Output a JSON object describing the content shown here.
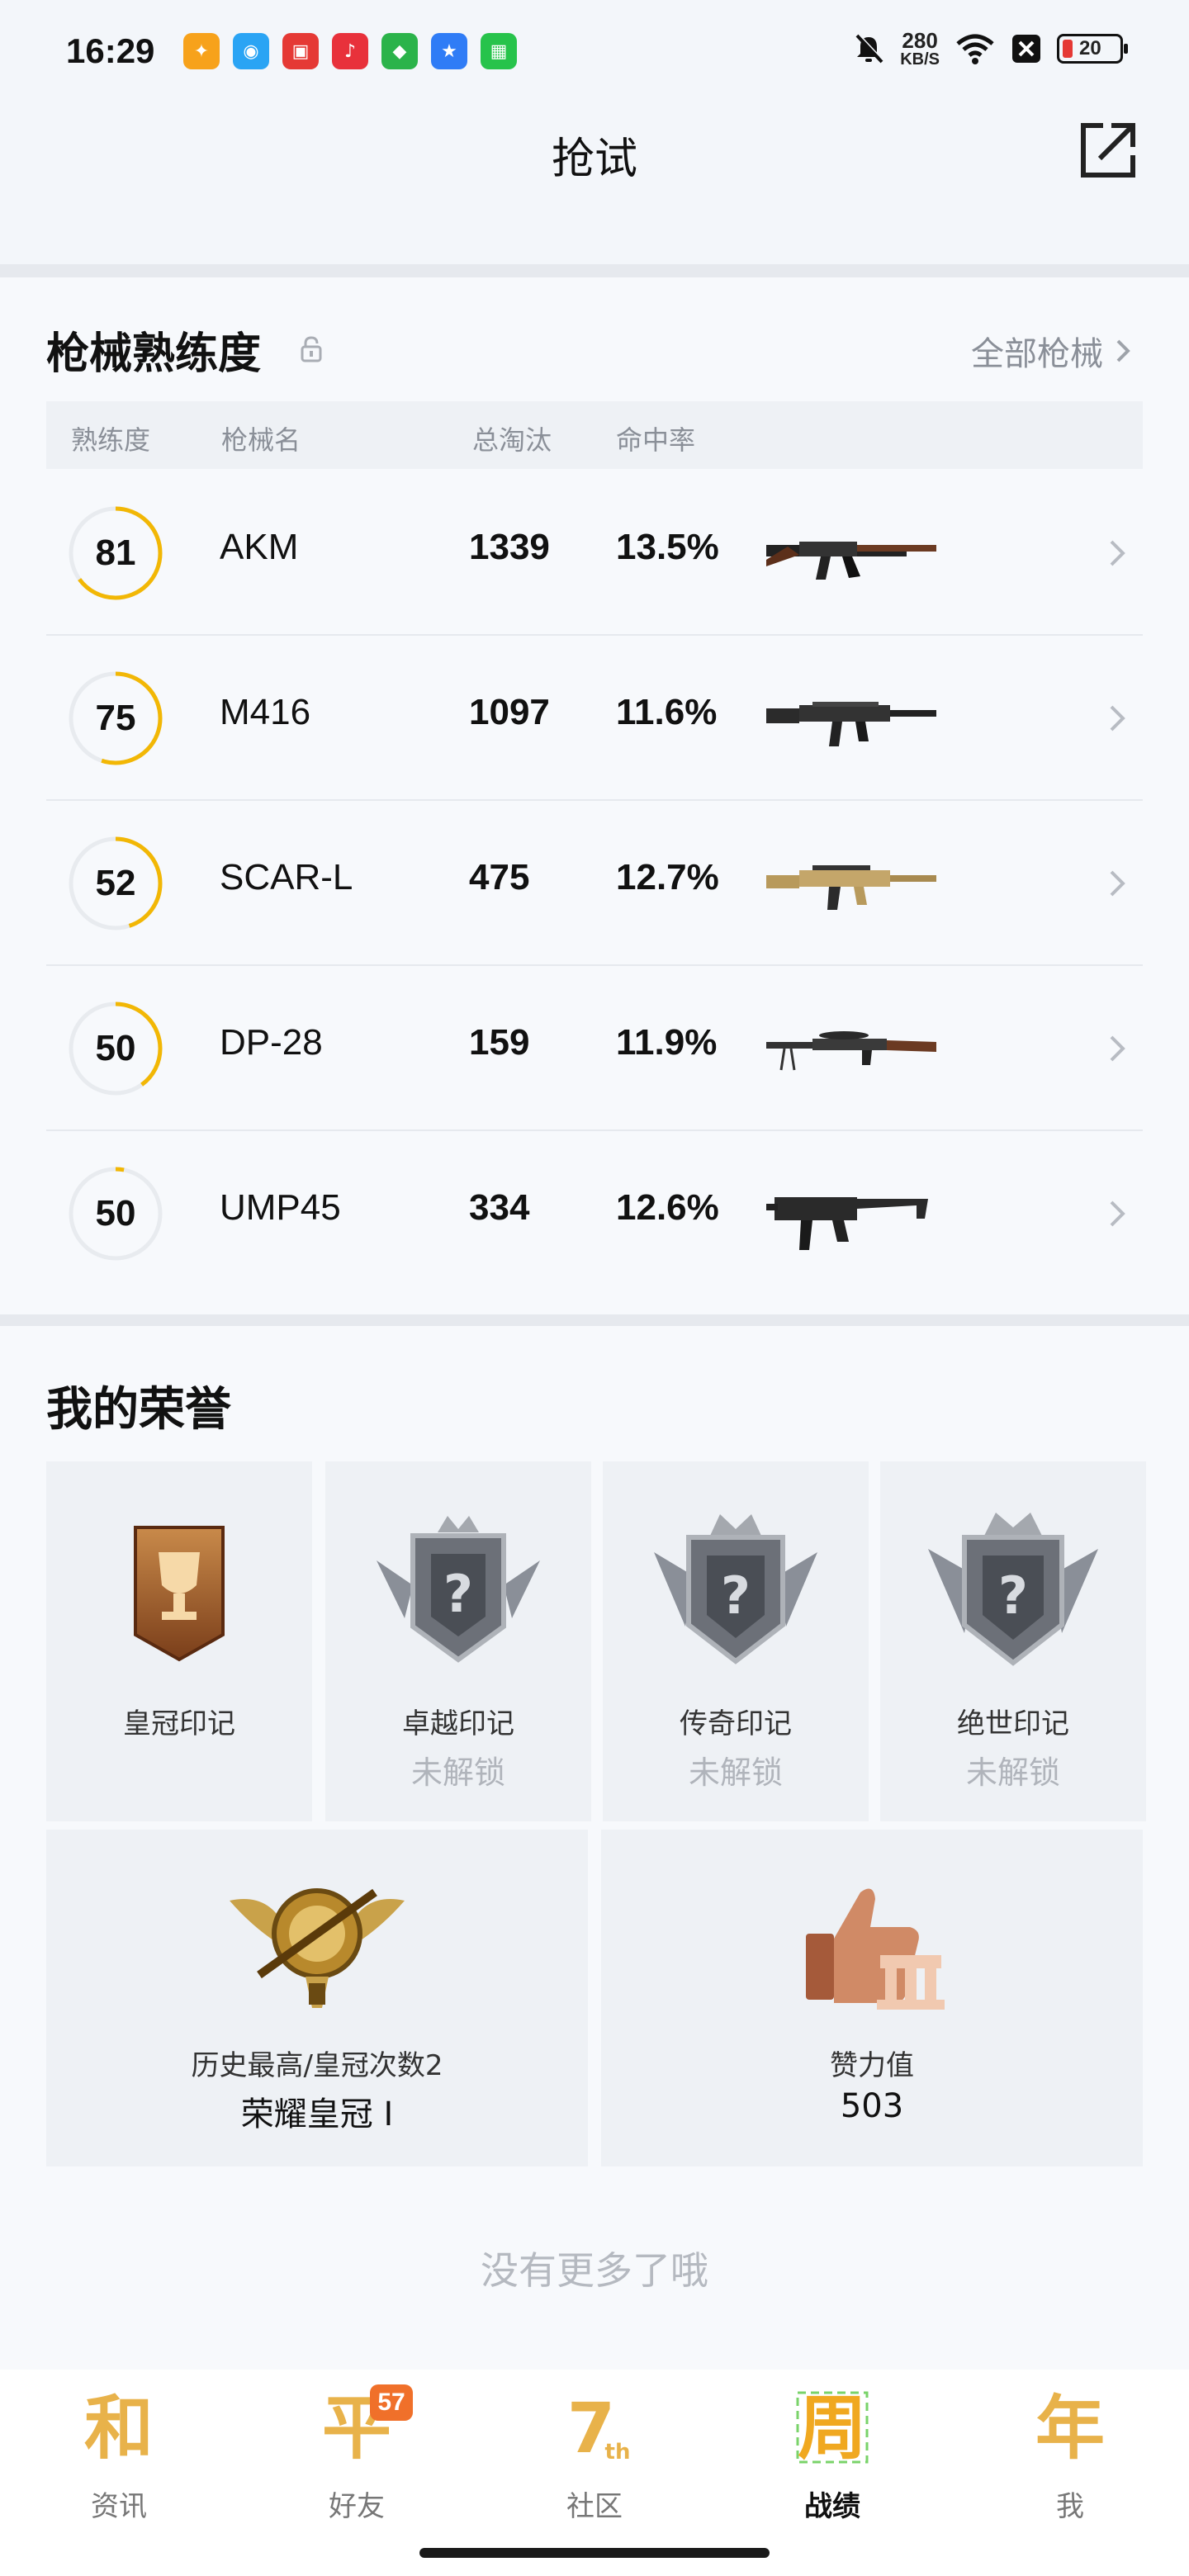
{
  "status_bar": {
    "time": "16:29",
    "net_speed_value": "280",
    "net_speed_unit": "KB/S",
    "battery": "20",
    "app_icons": [
      "game-icon",
      "qq-icon",
      "notice-icon",
      "music-icon",
      "shield-app-icon",
      "star-app-icon",
      "grid-app-icon"
    ]
  },
  "header": {
    "title": "抢试"
  },
  "weapons": {
    "title": "枪械熟练度",
    "all_link": "全部枪械",
    "columns": {
      "mastery": "熟练度",
      "name": "枪械名",
      "kills": "总淘汰",
      "hit_rate": "命中率"
    },
    "rows": [
      {
        "mastery": "81",
        "name": "AKM",
        "kills": "1339",
        "hit_rate": "13.5%",
        "progress": 0.65
      },
      {
        "mastery": "75",
        "name": "M416",
        "kills": "1097",
        "hit_rate": "11.6%",
        "progress": 0.55
      },
      {
        "mastery": "52",
        "name": "SCAR-L",
        "kills": "475",
        "hit_rate": "12.7%",
        "progress": 0.45
      },
      {
        "mastery": "50",
        "name": "DP-28",
        "kills": "159",
        "hit_rate": "11.9%",
        "progress": 0.4
      },
      {
        "mastery": "50",
        "name": "UMP45",
        "kills": "334",
        "hit_rate": "12.6%",
        "progress": 0.03
      }
    ]
  },
  "honor": {
    "title": "我的荣誉",
    "badges": [
      {
        "name": "皇冠印记",
        "status": ""
      },
      {
        "name": "卓越印记",
        "status": "未解锁"
      },
      {
        "name": "传奇印记",
        "status": "未解锁"
      },
      {
        "name": "绝世印记",
        "status": "未解锁"
      }
    ],
    "best_rank": {
      "label": "历史最高/皇冠次数2",
      "value": "荣耀皇冠 Ⅰ"
    },
    "likes": {
      "label": "赞力值",
      "value": "503"
    },
    "no_more": "没有更多了哦"
  },
  "bottom_nav": {
    "items": [
      {
        "label": "资讯",
        "glyph": "和",
        "active": false
      },
      {
        "label": "好友",
        "glyph": "平",
        "active": false,
        "badge": "57"
      },
      {
        "label": "社区",
        "glyph": "7",
        "active": false
      },
      {
        "label": "战绩",
        "glyph": "周",
        "active": true
      },
      {
        "label": "我",
        "glyph": "年",
        "active": false
      }
    ]
  },
  "colors": {
    "accent": "#f2b705",
    "nav_icon": "#e8b24a",
    "badge": "#f0702a"
  }
}
